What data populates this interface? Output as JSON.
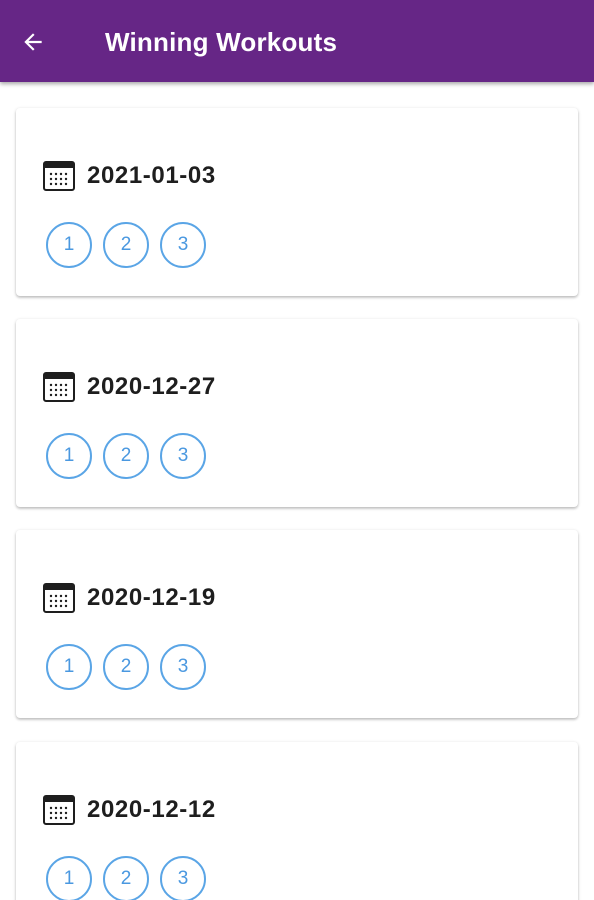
{
  "app": {
    "title": "Winning Workouts",
    "accent_color": "#662686",
    "button_color": "#4a98e0"
  },
  "toolbar": {
    "back_icon": "arrow-left-icon"
  },
  "workouts": [
    {
      "date": "2021-01-03",
      "icon": "calendar-icon",
      "buttons": [
        "1",
        "2",
        "3"
      ]
    },
    {
      "date": "2020-12-27",
      "icon": "calendar-icon",
      "buttons": [
        "1",
        "2",
        "3"
      ]
    },
    {
      "date": "2020-12-19",
      "icon": "calendar-icon",
      "buttons": [
        "1",
        "2",
        "3"
      ]
    },
    {
      "date": "2020-12-12",
      "icon": "calendar-icon",
      "buttons": [
        "1",
        "2",
        "3"
      ]
    }
  ]
}
